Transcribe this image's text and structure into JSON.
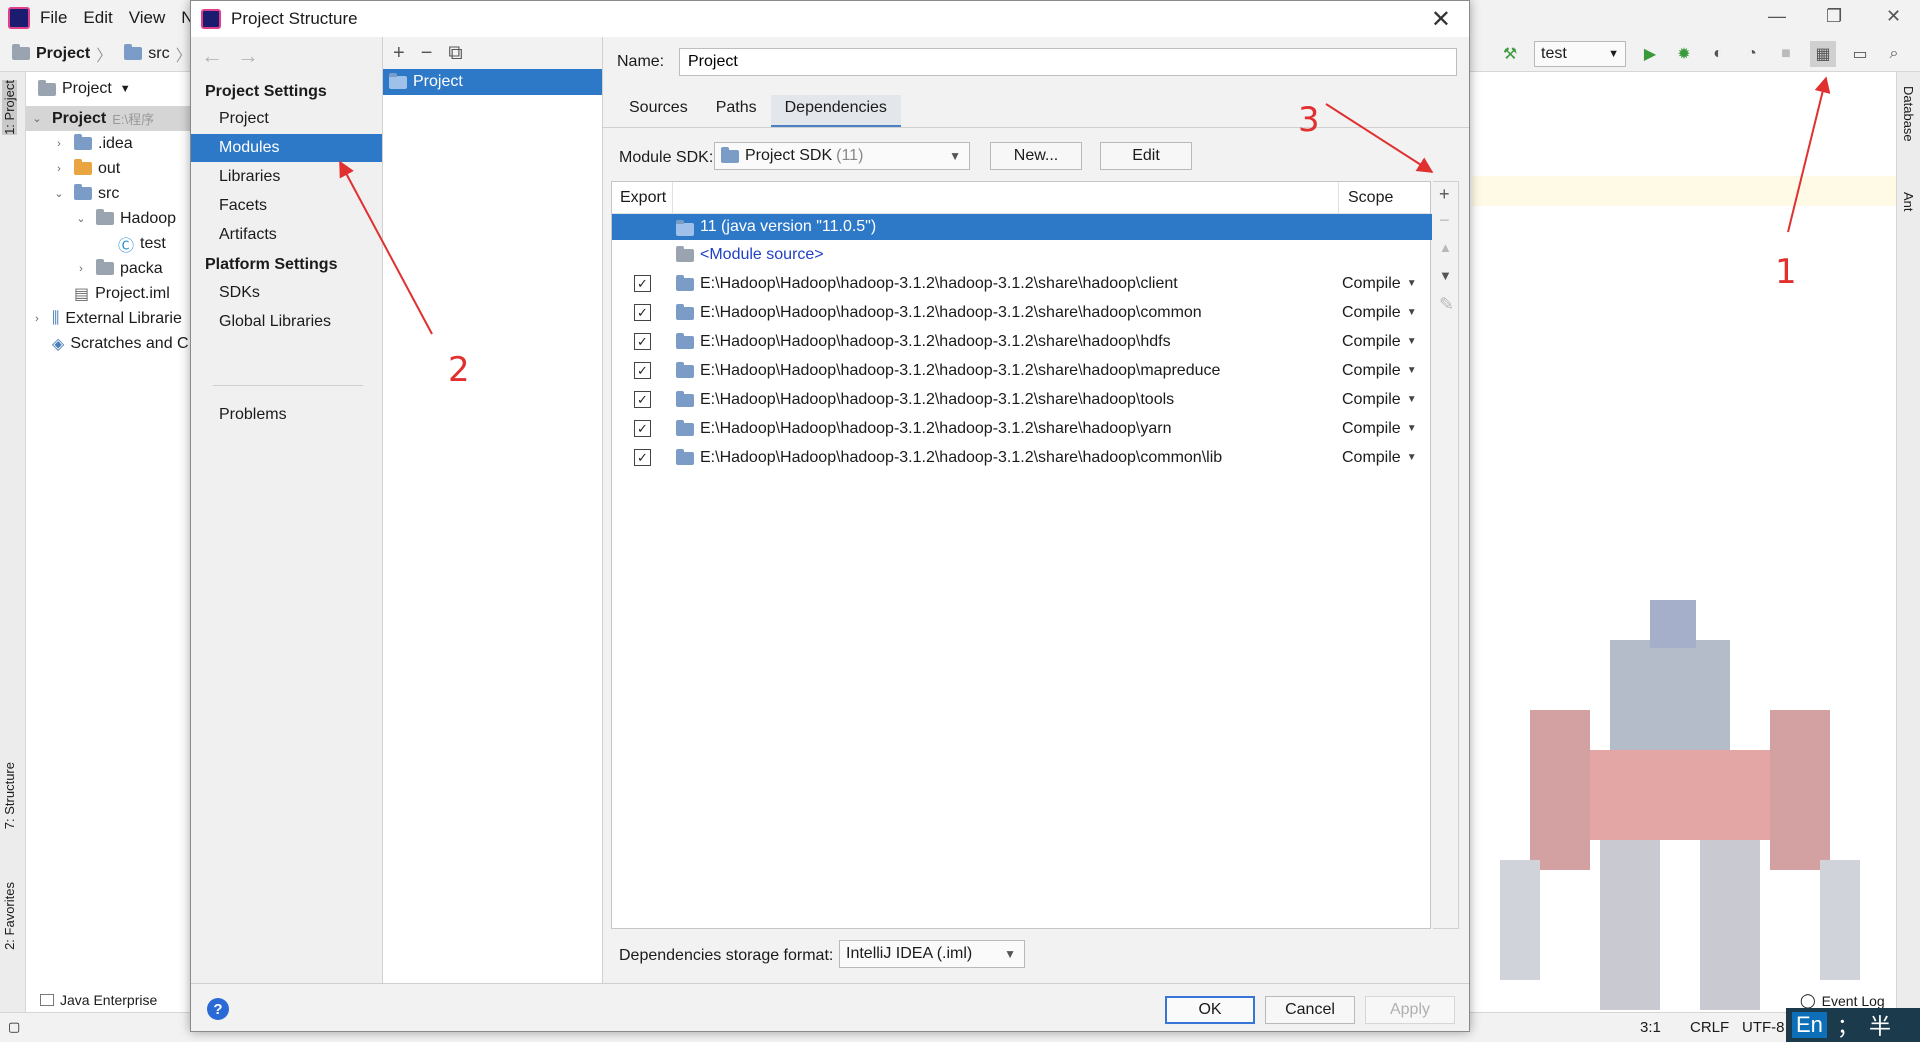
{
  "ide": {
    "menu": [
      "File",
      "Edit",
      "View",
      "N"
    ],
    "breadcrumb": [
      "Project",
      "src"
    ],
    "run_config": "test",
    "project_view_label": "Project",
    "tree": [
      {
        "label": "Project",
        "suffix": "E:\\程序",
        "bold": true,
        "level": 0,
        "chevron": "down"
      },
      {
        "label": ".idea",
        "level": 1,
        "chevron": "right",
        "icon": "folder"
      },
      {
        "label": "out",
        "level": 1,
        "chevron": "right",
        "icon": "folder-orange"
      },
      {
        "label": "src",
        "level": 1,
        "chevron": "down",
        "icon": "folder"
      },
      {
        "label": "Hadoop",
        "level": 2,
        "chevron": "down",
        "icon": "package"
      },
      {
        "label": "test",
        "level": 3,
        "chevron": "",
        "icon": "class"
      },
      {
        "label": "packa",
        "level": 2,
        "chevron": "right",
        "icon": "package"
      },
      {
        "label": "Project.iml",
        "level": 1,
        "chevron": "",
        "icon": "file"
      },
      {
        "label": "External Librarie",
        "level": 0,
        "chevron": "right",
        "icon": "libs"
      },
      {
        "label": "Scratches and C",
        "level": 0,
        "chevron": "",
        "icon": "scratch"
      }
    ],
    "left_tabs": [
      "1: Project",
      "7: Structure",
      "2: Favorites"
    ],
    "right_tabs": [
      "Database",
      "Ant"
    ],
    "bottom_tool": "Java Enterprise",
    "event_log": "Event Log",
    "status": {
      "position": "3:1",
      "line_sep": "CRLF",
      "encoding": "UTF-8"
    },
    "ime": {
      "lang": "En",
      "punct": "；",
      "width": "半"
    }
  },
  "dialog": {
    "title": "Project Structure",
    "nav": {
      "project_settings": "Project Settings",
      "project_items": [
        "Project",
        "Modules",
        "Libraries",
        "Facets",
        "Artifacts"
      ],
      "platform_settings": "Platform Settings",
      "platform_items": [
        "SDKs",
        "Global Libraries"
      ],
      "problems": "Problems",
      "selected": "Modules"
    },
    "modules": [
      "Project"
    ],
    "name_label": "Name:",
    "name_value": "Project",
    "tabs": [
      "Sources",
      "Paths",
      "Dependencies"
    ],
    "active_tab": "Dependencies",
    "sdk_label": "Module SDK:",
    "sdk_value": "Project SDK",
    "sdk_version": "(11)",
    "new_button": "New...",
    "edit_button": "Edit",
    "table": {
      "col_export": "Export",
      "col_scope": "Scope",
      "rows": [
        {
          "name": "11 (java version \"11.0.5\")",
          "checkbox": false,
          "scope": "",
          "selected": true,
          "link": false
        },
        {
          "name": "<Module source>",
          "checkbox": false,
          "scope": "",
          "selected": false,
          "link": true
        },
        {
          "name": "E:\\Hadoop\\Hadoop\\hadoop-3.1.2\\hadoop-3.1.2\\share\\hadoop\\client",
          "checkbox": true,
          "scope": "Compile",
          "selected": false,
          "link": false
        },
        {
          "name": "E:\\Hadoop\\Hadoop\\hadoop-3.1.2\\hadoop-3.1.2\\share\\hadoop\\common",
          "checkbox": true,
          "scope": "Compile",
          "selected": false,
          "link": false
        },
        {
          "name": "E:\\Hadoop\\Hadoop\\hadoop-3.1.2\\hadoop-3.1.2\\share\\hadoop\\hdfs",
          "checkbox": true,
          "scope": "Compile",
          "selected": false,
          "link": false
        },
        {
          "name": "E:\\Hadoop\\Hadoop\\hadoop-3.1.2\\hadoop-3.1.2\\share\\hadoop\\mapreduce",
          "checkbox": true,
          "scope": "Compile",
          "selected": false,
          "link": false
        },
        {
          "name": "E:\\Hadoop\\Hadoop\\hadoop-3.1.2\\hadoop-3.1.2\\share\\hadoop\\tools",
          "checkbox": true,
          "scope": "Compile",
          "selected": false,
          "link": false
        },
        {
          "name": "E:\\Hadoop\\Hadoop\\hadoop-3.1.2\\hadoop-3.1.2\\share\\hadoop\\yarn",
          "checkbox": true,
          "scope": "Compile",
          "selected": false,
          "link": false
        },
        {
          "name": "E:\\Hadoop\\Hadoop\\hadoop-3.1.2\\hadoop-3.1.2\\share\\hadoop\\common\\lib",
          "checkbox": true,
          "scope": "Compile",
          "selected": false,
          "link": false
        }
      ]
    },
    "storage_label": "Dependencies storage format:",
    "storage_value": "IntelliJ IDEA (.iml)",
    "buttons": {
      "ok": "OK",
      "cancel": "Cancel",
      "apply": "Apply"
    }
  },
  "annotations": [
    "1",
    "2",
    "3"
  ],
  "colors": {
    "selection": "#2d79c8",
    "annotation": "#e03030",
    "link": "#2140c4"
  }
}
